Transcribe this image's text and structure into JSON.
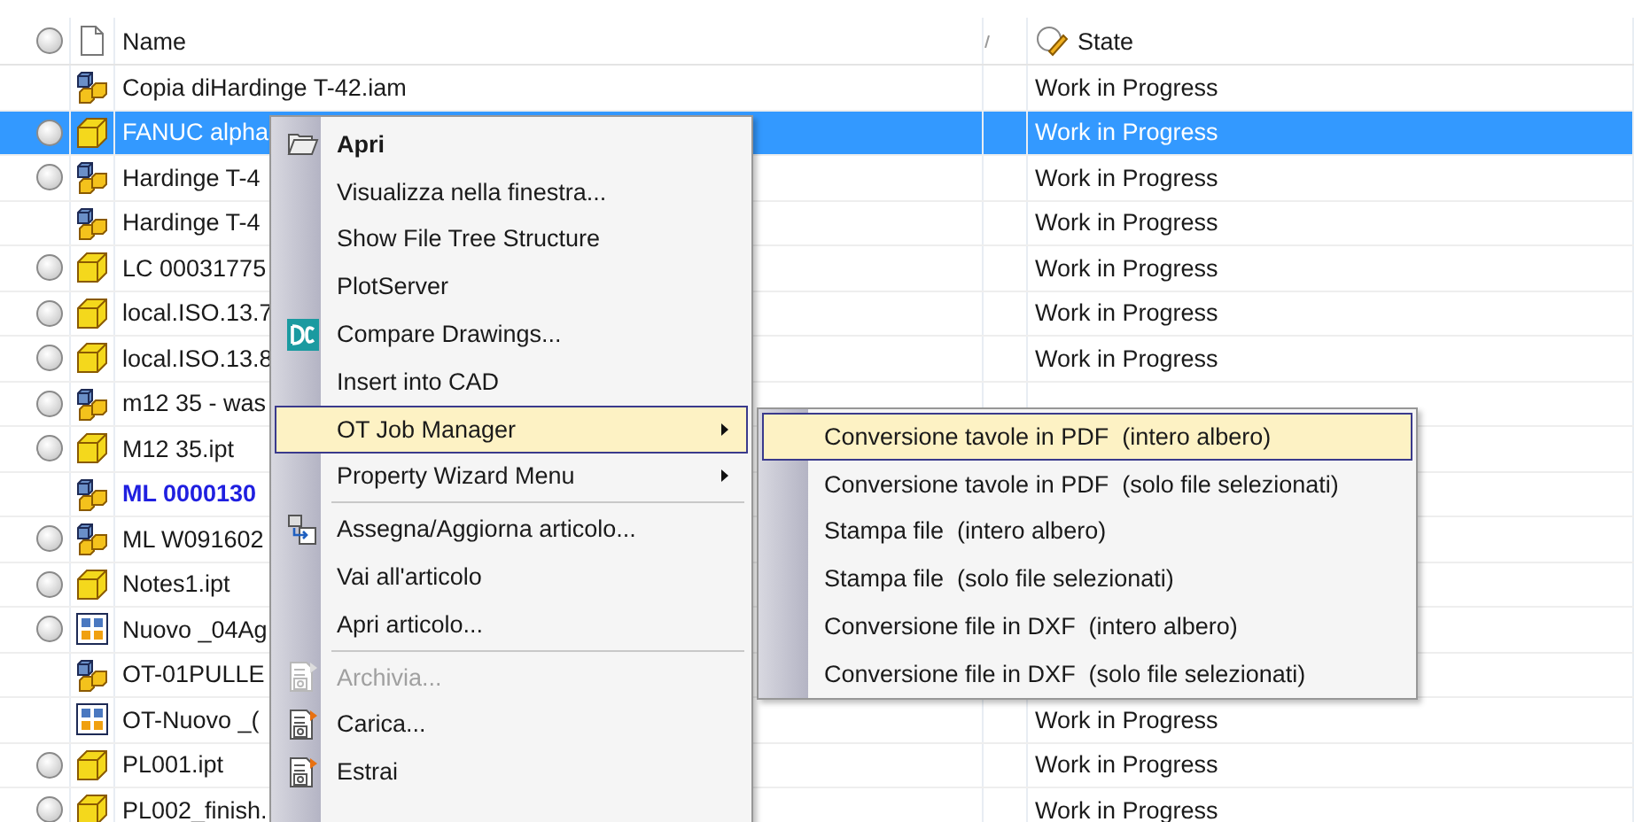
{
  "header": {
    "name_label": "Name",
    "state_label": "State"
  },
  "rows": [
    {
      "circle": false,
      "kind": "assembly",
      "name": "Copia diHardinge T-42.iam",
      "state": "Work in Progress",
      "selected": false,
      "emphasized": false
    },
    {
      "circle": true,
      "kind": "part",
      "name": "FANUC alpha",
      "state": "Work in Progress",
      "selected": true,
      "emphasized": false
    },
    {
      "circle": true,
      "kind": "assembly",
      "name": "Hardinge T-4",
      "state": "Work in Progress",
      "selected": false,
      "emphasized": false
    },
    {
      "circle": false,
      "kind": "assembly",
      "name": "Hardinge T-4",
      "state": "Work in Progress",
      "selected": false,
      "emphasized": false
    },
    {
      "circle": true,
      "kind": "part",
      "name": "LC 00031775",
      "state": "Work in Progress",
      "selected": false,
      "emphasized": false
    },
    {
      "circle": true,
      "kind": "part",
      "name": "local.ISO.13.7",
      "state": "Work in Progress",
      "selected": false,
      "emphasized": false
    },
    {
      "circle": true,
      "kind": "part",
      "name": "local.ISO.13.8",
      "state": "Work in Progress",
      "selected": false,
      "emphasized": false
    },
    {
      "circle": true,
      "kind": "assembly",
      "name": "m12 35 - was",
      "selected": false,
      "emphasized": false
    },
    {
      "circle": true,
      "kind": "part",
      "name": "M12 35.ipt",
      "selected": false,
      "emphasized": false
    },
    {
      "circle": false,
      "kind": "assembly",
      "name": "ML 0000130",
      "selected": false,
      "emphasized": true
    },
    {
      "circle": true,
      "kind": "assembly",
      "name": "ML W091602",
      "selected": false,
      "emphasized": false
    },
    {
      "circle": true,
      "kind": "part",
      "name": "Notes1.ipt",
      "selected": false,
      "emphasized": false
    },
    {
      "circle": true,
      "kind": "drawing",
      "name": "Nuovo _04Ag",
      "selected": false,
      "emphasized": false
    },
    {
      "circle": false,
      "kind": "assembly",
      "name": "OT-01PULLE",
      "selected": false,
      "emphasized": false
    },
    {
      "circle": false,
      "kind": "drawing",
      "name": "OT-Nuovo _(",
      "state": "Work in Progress",
      "selected": false,
      "emphasized": false
    },
    {
      "circle": true,
      "kind": "part",
      "name": "PL001.ipt",
      "state": "Work in Progress",
      "selected": false,
      "emphasized": false
    },
    {
      "circle": true,
      "kind": "part",
      "name": "PL002_finish.",
      "state": "Work in Progress",
      "selected": false,
      "emphasized": false
    }
  ],
  "context_menu": {
    "groups": [
      {
        "items": [
          {
            "label": "Apri",
            "kind": "folder",
            "bold": true,
            "disabled": false,
            "selected": false,
            "submenu": false
          },
          {
            "label": "Visualizza nella finestra...",
            "kind": "plain",
            "bold": false,
            "disabled": false,
            "selected": false,
            "submenu": false
          },
          {
            "label": "Show File Tree Structure",
            "kind": "plain",
            "bold": false,
            "disabled": false,
            "selected": false,
            "submenu": false
          },
          {
            "label": "PlotServer",
            "kind": "plain",
            "bold": false,
            "disabled": false,
            "selected": false,
            "submenu": false
          },
          {
            "label": "Compare Drawings...",
            "kind": "compare",
            "bold": false,
            "disabled": false,
            "selected": false,
            "submenu": false
          },
          {
            "label": "Insert into CAD",
            "kind": "plain",
            "bold": false,
            "disabled": false,
            "selected": false,
            "submenu": false
          },
          {
            "label": "OT Job Manager",
            "kind": "plain",
            "bold": false,
            "disabled": false,
            "selected": true,
            "submenu": true
          },
          {
            "label": "Property Wizard Menu",
            "kind": "plain",
            "bold": false,
            "disabled": false,
            "selected": false,
            "submenu": true
          }
        ]
      },
      {
        "items": [
          {
            "label": "Assegna/Aggiorna articolo...",
            "kind": "assign",
            "bold": false,
            "disabled": false,
            "selected": false,
            "submenu": false
          },
          {
            "label": "Vai all'articolo",
            "kind": "plain",
            "bold": false,
            "disabled": false,
            "selected": false,
            "submenu": false
          },
          {
            "label": "Apri articolo...",
            "kind": "plain",
            "bold": false,
            "disabled": false,
            "selected": false,
            "submenu": false
          }
        ]
      },
      {
        "items": [
          {
            "label": "Archivia...",
            "kind": "vault",
            "bold": false,
            "disabled": true,
            "selected": false,
            "submenu": false
          },
          {
            "label": "Carica...",
            "kind": "vault",
            "bold": false,
            "disabled": false,
            "selected": false,
            "submenu": false
          },
          {
            "label": "Estrai",
            "kind": "vault",
            "bold": false,
            "disabled": false,
            "selected": false,
            "submenu": false
          }
        ]
      }
    ]
  },
  "submenu": [
    {
      "label": "Conversione tavole in PDF  (intero albero)",
      "selected": true
    },
    {
      "label": "Conversione tavole in PDF  (solo file selezionati)",
      "selected": false
    },
    {
      "label": "Stampa file  (intero albero)",
      "selected": false
    },
    {
      "label": "Stampa file  (solo file selezionati)",
      "selected": false
    },
    {
      "label": "Conversione file in DXF  (intero albero)",
      "selected": false
    },
    {
      "label": "Conversione file in DXF  (solo file selezionati)",
      "selected": false
    }
  ]
}
